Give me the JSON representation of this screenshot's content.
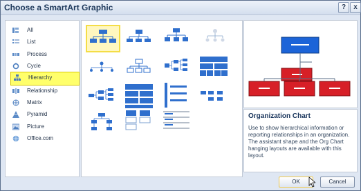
{
  "window": {
    "title": "Choose a SmartArt Graphic",
    "help_label": "?",
    "close_label": "x"
  },
  "categories": [
    {
      "label": "All",
      "icon": "all-icon"
    },
    {
      "label": "List",
      "icon": "list-icon"
    },
    {
      "label": "Process",
      "icon": "process-icon"
    },
    {
      "label": "Cycle",
      "icon": "cycle-icon"
    },
    {
      "label": "Hierarchy",
      "icon": "hierarchy-icon",
      "selected": true
    },
    {
      "label": "Relationship",
      "icon": "relationship-icon"
    },
    {
      "label": "Matrix",
      "icon": "matrix-icon"
    },
    {
      "label": "Pyramid",
      "icon": "pyramid-icon"
    },
    {
      "label": "Picture",
      "icon": "picture-icon"
    },
    {
      "label": "Office.com",
      "icon": "office-icon"
    }
  ],
  "selection": {
    "name": "Organization Chart",
    "description": "Use to show hierarchical information or reporting relationships in an organization. The assistant shape and the Org Chart hanging layouts are available with this layout."
  },
  "buttons": {
    "ok": "OK",
    "cancel": "Cancel"
  },
  "colors": {
    "preview_blue": "#1c64d8",
    "preview_red": "#d71f27",
    "highlight": "#ffff6b"
  }
}
